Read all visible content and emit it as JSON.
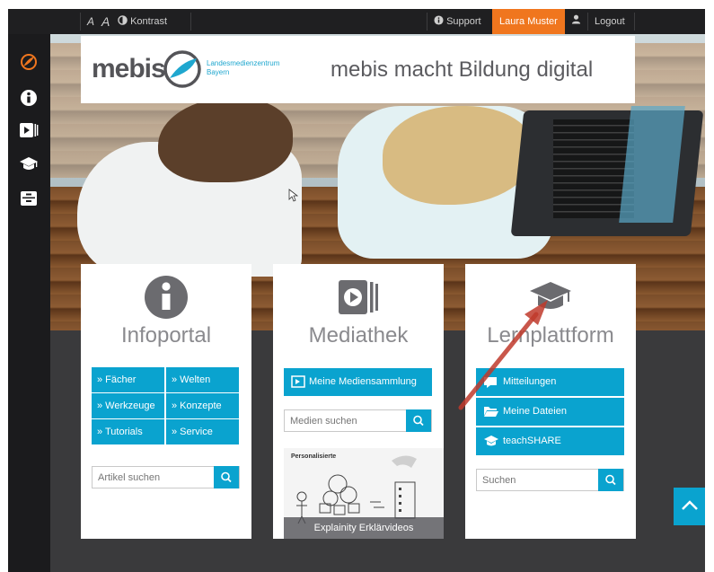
{
  "topbar": {
    "font_smaller": "A",
    "font_larger": "A",
    "contrast_label": "Kontrast",
    "support_label": "Support",
    "user_name": "Laura Muster",
    "logout_label": "Logout"
  },
  "sidebar": {
    "items": [
      {
        "icon": "mebis-logo-icon"
      },
      {
        "icon": "info-icon"
      },
      {
        "icon": "media-player-icon"
      },
      {
        "icon": "graduation-cap-icon"
      },
      {
        "icon": "drawer-icon"
      }
    ]
  },
  "banner": {
    "logo": "mebis",
    "logo_sub_line1": "Landesmedienzentrum",
    "logo_sub_line2": "Bayern",
    "tagline": "mebis macht Bildung digital"
  },
  "infoportal": {
    "title": "Infoportal",
    "links": [
      "» Fächer",
      "» Welten",
      "» Werkzeuge",
      "» Konzepte",
      "» Tutorials",
      "» Service"
    ],
    "search_placeholder": "Artikel suchen"
  },
  "mediathek": {
    "title": "Mediathek",
    "collection_button": "Meine Mediensammlung",
    "search_placeholder": "Medien suchen",
    "video_heading": "Personalisierte",
    "video_caption": "Explainity Erklärvideos"
  },
  "lernplattform": {
    "title": "Lernplattform",
    "buttons": [
      "Mitteilungen",
      "Meine Dateien",
      "teachSHARE"
    ],
    "search_placeholder": "Suchen"
  },
  "colors": {
    "accent": "#0aa3cf",
    "user_badge": "#f0761e",
    "annotation_arrow": "#c0392b"
  }
}
